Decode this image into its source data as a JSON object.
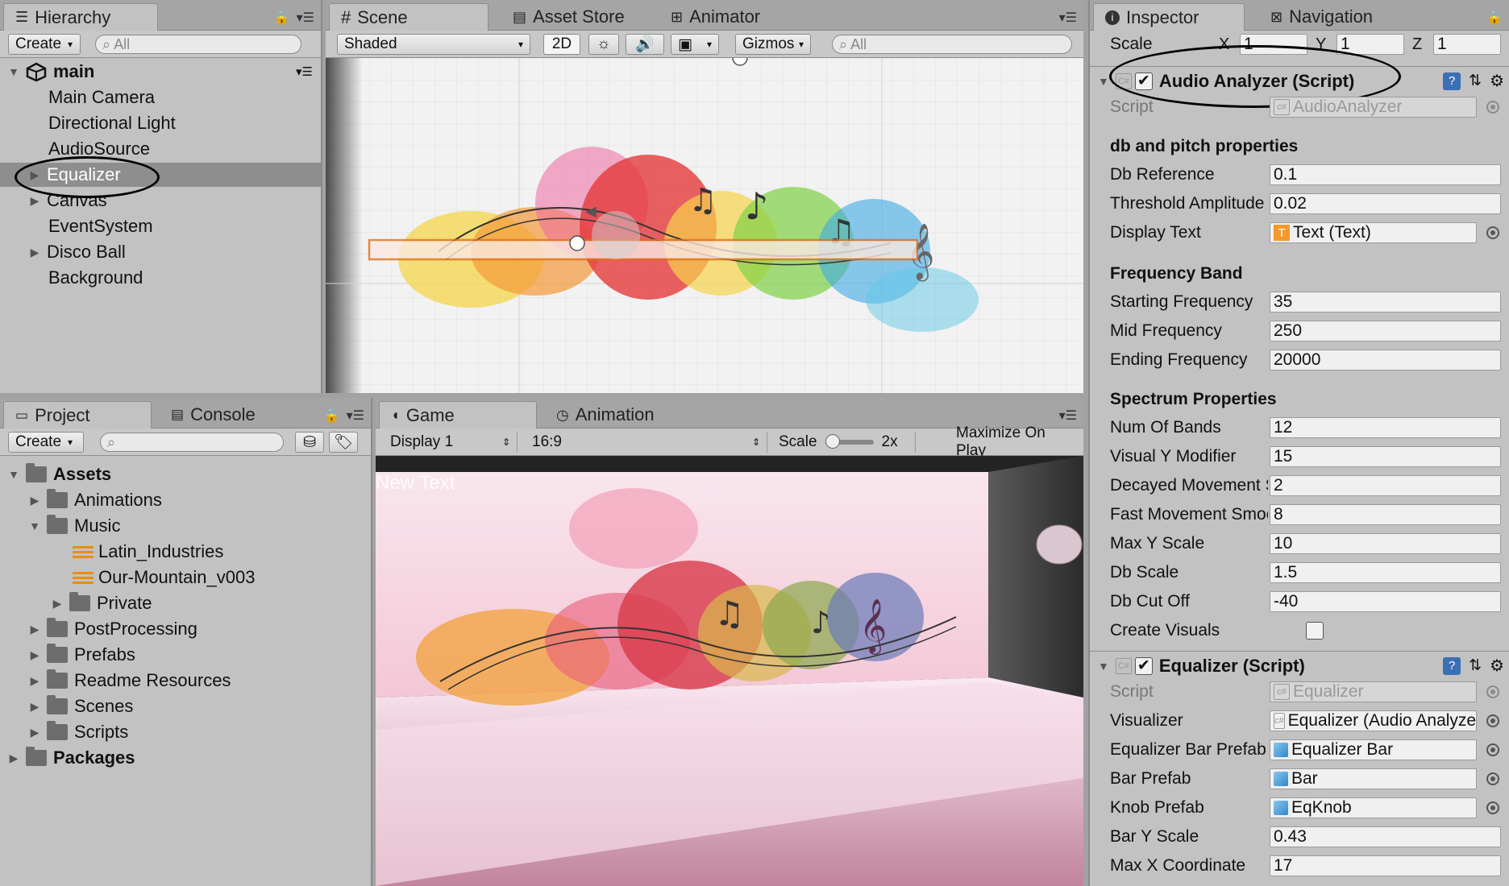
{
  "hierarchy": {
    "tab_label": "Hierarchy",
    "create_label": "Create",
    "search_placeholder": "All",
    "scene_name": "main",
    "items": [
      {
        "label": "Main Camera"
      },
      {
        "label": "Directional Light"
      },
      {
        "label": "AudioSource"
      },
      {
        "label": "Equalizer",
        "selected": true
      },
      {
        "label": "Canvas"
      },
      {
        "label": "EventSystem"
      },
      {
        "label": "Disco Ball"
      },
      {
        "label": "Background"
      }
    ]
  },
  "scene": {
    "tabs": [
      "Scene",
      "Asset Store",
      "Animator"
    ],
    "shading_mode": "Shaded",
    "mode_2d": "2D",
    "gizmos_label": "Gizmos",
    "search_placeholder": "All"
  },
  "project": {
    "tabs": [
      "Project",
      "Console"
    ],
    "create_label": "Create",
    "tree": [
      {
        "label": "Assets",
        "bold": true
      },
      {
        "label": "Animations"
      },
      {
        "label": "Music"
      },
      {
        "label": "Latin_Industries"
      },
      {
        "label": "Our-Mountain_v003"
      },
      {
        "label": "Private"
      },
      {
        "label": "PostProcessing"
      },
      {
        "label": "Prefabs"
      },
      {
        "label": "Readme Resources"
      },
      {
        "label": "Scenes"
      },
      {
        "label": "Scripts"
      },
      {
        "label": "Packages",
        "bold": true
      }
    ]
  },
  "game": {
    "tabs": [
      "Game",
      "Animation"
    ],
    "display": "Display 1",
    "aspect": "16:9",
    "scale_label": "Scale",
    "scale_value": "2x",
    "scale_level": 0.05,
    "maximize_label": "Maximize On Play",
    "overlay_text": "New Text"
  },
  "inspector": {
    "tabs": [
      "Inspector",
      "Navigation"
    ],
    "scale": {
      "label": "Scale",
      "x_label": "X",
      "x": "1",
      "y_label": "Y",
      "y": "1",
      "z_label": "Z",
      "z": "1"
    },
    "audio_analyzer": {
      "title": "Audio Analyzer (Script)",
      "enabled": true,
      "script_label": "Script",
      "script_value": "AudioAnalyzer",
      "sections": {
        "db": "db and pitch properties",
        "freq": "Frequency Band",
        "spectrum": "Spectrum Properties"
      },
      "fields": [
        {
          "label": "Db Reference",
          "value": "0.1"
        },
        {
          "label": "Threshold Amplitude",
          "value": "0.02"
        },
        {
          "label": "Display Text",
          "value": "Text (Text)"
        },
        {
          "label": "Starting Frequency",
          "value": "35"
        },
        {
          "label": "Mid Frequency",
          "value": "250"
        },
        {
          "label": "Ending Frequency",
          "value": "20000"
        },
        {
          "label": "Num Of Bands",
          "value": "12"
        },
        {
          "label": "Visual Y Modifier",
          "value": "15"
        },
        {
          "label": "Decayed Movement Smoothing",
          "value": "2"
        },
        {
          "label": "Fast Movement Smoothing",
          "value": "8"
        },
        {
          "label": "Max Y Scale",
          "value": "10"
        },
        {
          "label": "Db Scale",
          "value": "1.5"
        },
        {
          "label": "Db Cut Off",
          "value": "-40"
        },
        {
          "label": "Create Visuals",
          "value": ""
        }
      ]
    },
    "equalizer": {
      "title": "Equalizer (Script)",
      "enabled": true,
      "script_label": "Script",
      "script_value": "Equalizer",
      "fields": [
        {
          "label": "Visualizer",
          "value": "Equalizer (Audio Analyzer)"
        },
        {
          "label": "Equalizer Bar Prefab",
          "value": "Equalizer Bar"
        },
        {
          "label": "Bar Prefab",
          "value": "Bar"
        },
        {
          "label": "Knob Prefab",
          "value": "EqKnob"
        },
        {
          "label": "Bar Y Scale",
          "value": "0.43"
        },
        {
          "label": "Max X Coordinate",
          "value": "17"
        }
      ]
    }
  }
}
